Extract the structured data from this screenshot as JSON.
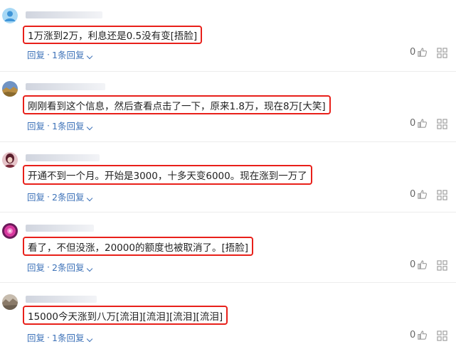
{
  "comments": [
    {
      "text": "1万涨到2万，利息还是0.5没有变[捂脸]",
      "reply_label": "回复",
      "separator": "·",
      "replies_label": "1条回复",
      "likes": "0",
      "avatar_colors": [
        "#9fd4f3",
        "#4c9edc"
      ],
      "avatar_icon": "default-user-icon"
    },
    {
      "text": "刚刚看到这个信息，然后查看点击了一下，原来1.8万，现在8万[大笑]",
      "reply_label": "回复",
      "separator": "·",
      "replies_label": "1条回复",
      "likes": "0",
      "avatar_colors": [
        "#5f83b6",
        "#b0873b"
      ],
      "avatar_icon": "landscape-photo-icon"
    },
    {
      "text": "开通不到一个月。开始是3000，十多天变6000。现在涨到一万了",
      "reply_label": "回复",
      "separator": "·",
      "replies_label": "2条回复",
      "likes": "0",
      "avatar_colors": [
        "#7a2a3a",
        "#e8c3c8"
      ],
      "avatar_icon": "portrait-photo-icon"
    },
    {
      "text": "看了，不但没涨，20000的额度也被取消了。[捂脸]",
      "reply_label": "回复",
      "separator": "·",
      "replies_label": "2条回复",
      "likes": "0",
      "avatar_colors": [
        "#d63aa4",
        "#7a1f66"
      ],
      "avatar_icon": "flower-photo-icon"
    },
    {
      "text": "15000今天涨到八万[流泪][流泪][流泪][流泪]",
      "reply_label": "回复",
      "separator": "·",
      "replies_label": "1条回复",
      "likes": "0",
      "avatar_colors": [
        "#8a7a6a",
        "#c9bfb3"
      ],
      "avatar_icon": "scenery-photo-icon"
    }
  ]
}
